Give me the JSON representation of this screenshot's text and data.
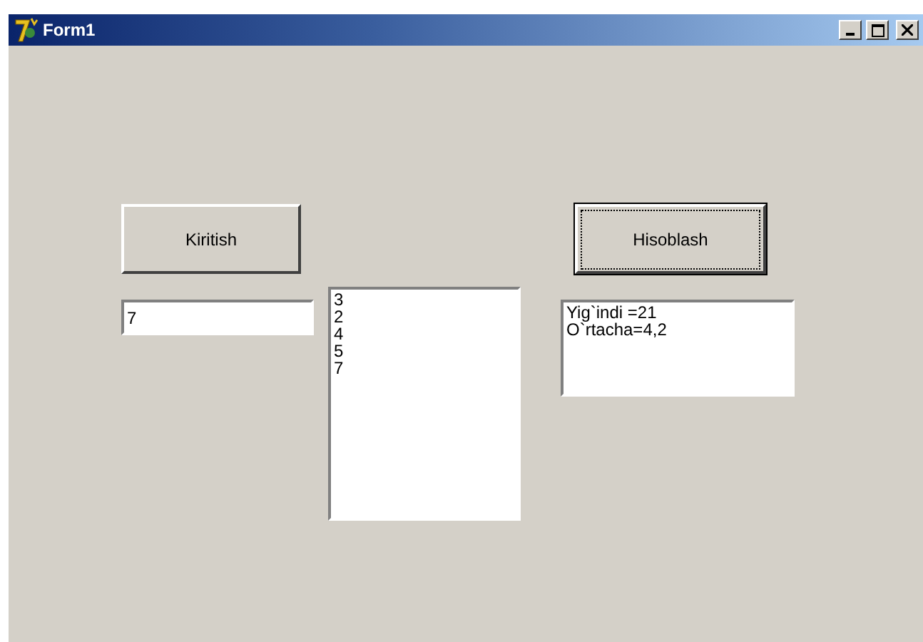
{
  "window": {
    "title": "Form1"
  },
  "buttons": [
    {
      "label": "Kiritish",
      "focused": false
    },
    {
      "label": "Hisoblash",
      "focused": true
    }
  ],
  "edit": {
    "value": "7"
  },
  "listbox": {
    "items": [
      "3",
      "2",
      "4",
      "5",
      "7"
    ]
  },
  "memo": {
    "lines": [
      "Yig`indi =21",
      "O`rtacha=4,2"
    ]
  }
}
